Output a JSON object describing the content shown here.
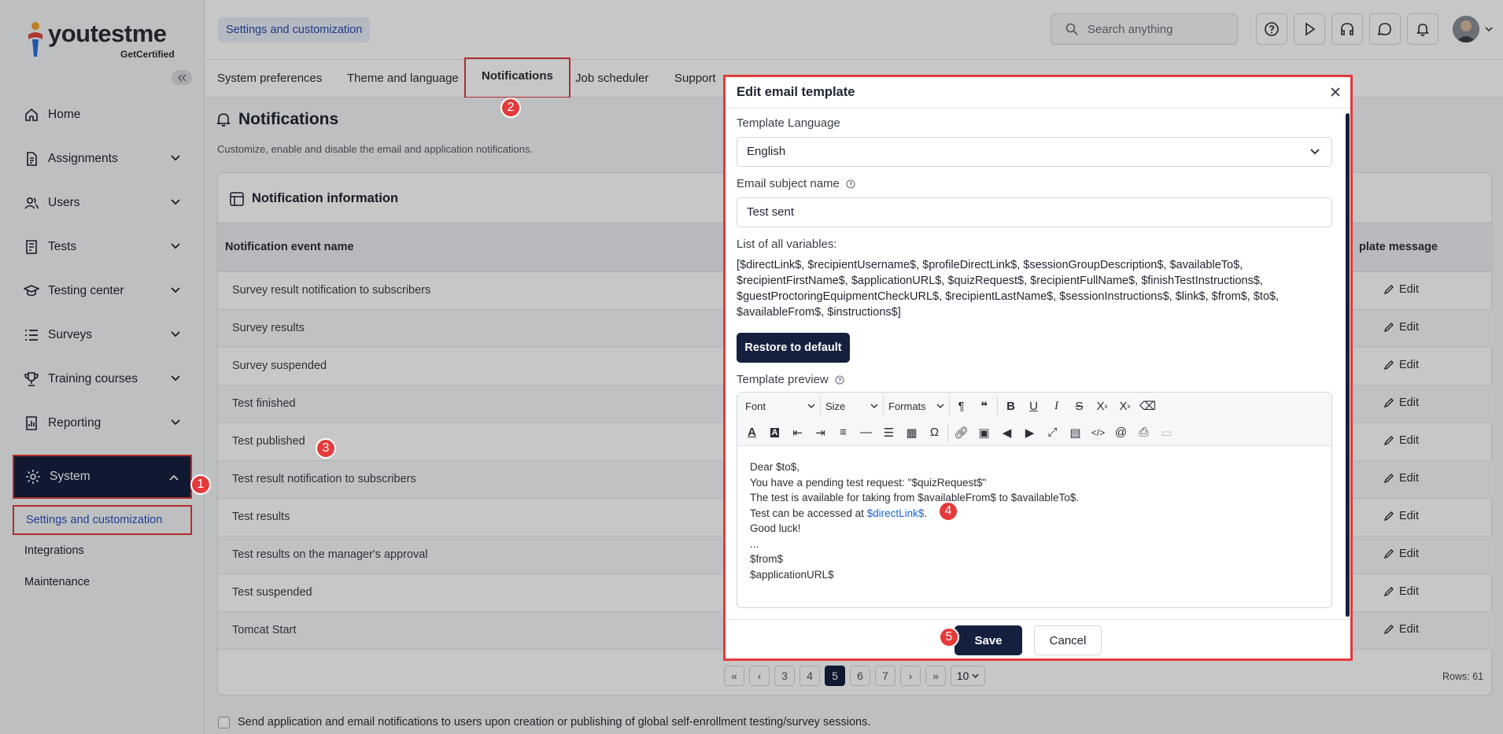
{
  "app": {
    "logo_text": "youtestme",
    "logo_sub": "GetCertified"
  },
  "sidebar": {
    "items": [
      {
        "label": "Home",
        "icon": "home-icon"
      },
      {
        "label": "Assignments",
        "icon": "assignments-icon"
      },
      {
        "label": "Users",
        "icon": "users-icon"
      },
      {
        "label": "Tests",
        "icon": "tests-icon"
      },
      {
        "label": "Testing center",
        "icon": "testing-center-icon"
      },
      {
        "label": "Surveys",
        "icon": "surveys-icon"
      },
      {
        "label": "Training courses",
        "icon": "trophy-icon"
      },
      {
        "label": "Reporting",
        "icon": "reporting-icon"
      },
      {
        "label": "System",
        "icon": "gear-icon"
      }
    ],
    "subitems": [
      "Settings and customization",
      "Integrations",
      "Maintenance"
    ]
  },
  "topbar": {
    "breadcrumb": "Settings and customization",
    "search_placeholder": "Search anything"
  },
  "tabs": [
    "System preferences",
    "Theme and language",
    "Notifications",
    "Job scheduler",
    "Support"
  ],
  "page": {
    "title": "Notifications",
    "description": "Customize, enable and disable the email and application notifications.",
    "card_title": "Notification information",
    "col_event": "Notification event name",
    "col_message": "plate message",
    "edit_label": "Edit",
    "rows": [
      "Survey result notification to subscribers",
      "Survey results",
      "Survey suspended",
      "Test finished",
      "Test published",
      "Test result notification to subscribers",
      "Test results",
      "Test results on the manager's approval",
      "Test suspended",
      "Tomcat Start"
    ],
    "pager": {
      "first": "«",
      "prev": "‹",
      "pages": [
        "3",
        "4",
        "5",
        "6",
        "7"
      ],
      "current": "5",
      "next": "›",
      "last": "»",
      "page_size": "10",
      "rows_label": "Rows: 61"
    },
    "footer_checkbox": "Send application and email notifications to users upon creation or publishing of global self-enrollment testing/survey sessions."
  },
  "modal": {
    "title": "Edit email template",
    "template_language_label": "Template Language",
    "template_language_value": "English",
    "subject_label": "Email subject name",
    "subject_value": "Test sent",
    "variables_label": "List of all variables:",
    "variables_text": "[$directLink$, $recipientUsername$, $profileDirectLink$, $sessionGroupDescription$, $availableTo$, $recipientFirstName$, $applicationURL$, $quizRequest$, $recipientFullName$, $finishTestInstructions$, $guestProctoringEquipmentCheckURL$, $recipientLastName$, $sessionInstructions$, $link$, $from$, $to$, $availableFrom$, $instructions$]",
    "restore_button": "Restore to default",
    "preview_label": "Template preview",
    "toolbar": {
      "font": "Font",
      "size": "Size",
      "formats": "Formats"
    },
    "content": {
      "line1": "Dear $to$,",
      "line2": "You have a pending test request: \"$quizRequest$\"",
      "line3": "The test is available for taking from $availableFrom$ to $availableTo$.",
      "line4_prefix": "Test can be accessed at ",
      "line4_link": "$directLink$",
      "line4_suffix": ".",
      "line5": "Good luck!",
      "line6": "...",
      "line7": "$from$",
      "line8": "$applicationURL$"
    },
    "save_button": "Save",
    "cancel_button": "Cancel"
  },
  "annotations": [
    "1",
    "2",
    "3",
    "4",
    "5"
  ],
  "colors": {
    "accent_dark": "#15203f",
    "highlight_red": "#e53a3a",
    "link_blue": "#1d63d6"
  }
}
